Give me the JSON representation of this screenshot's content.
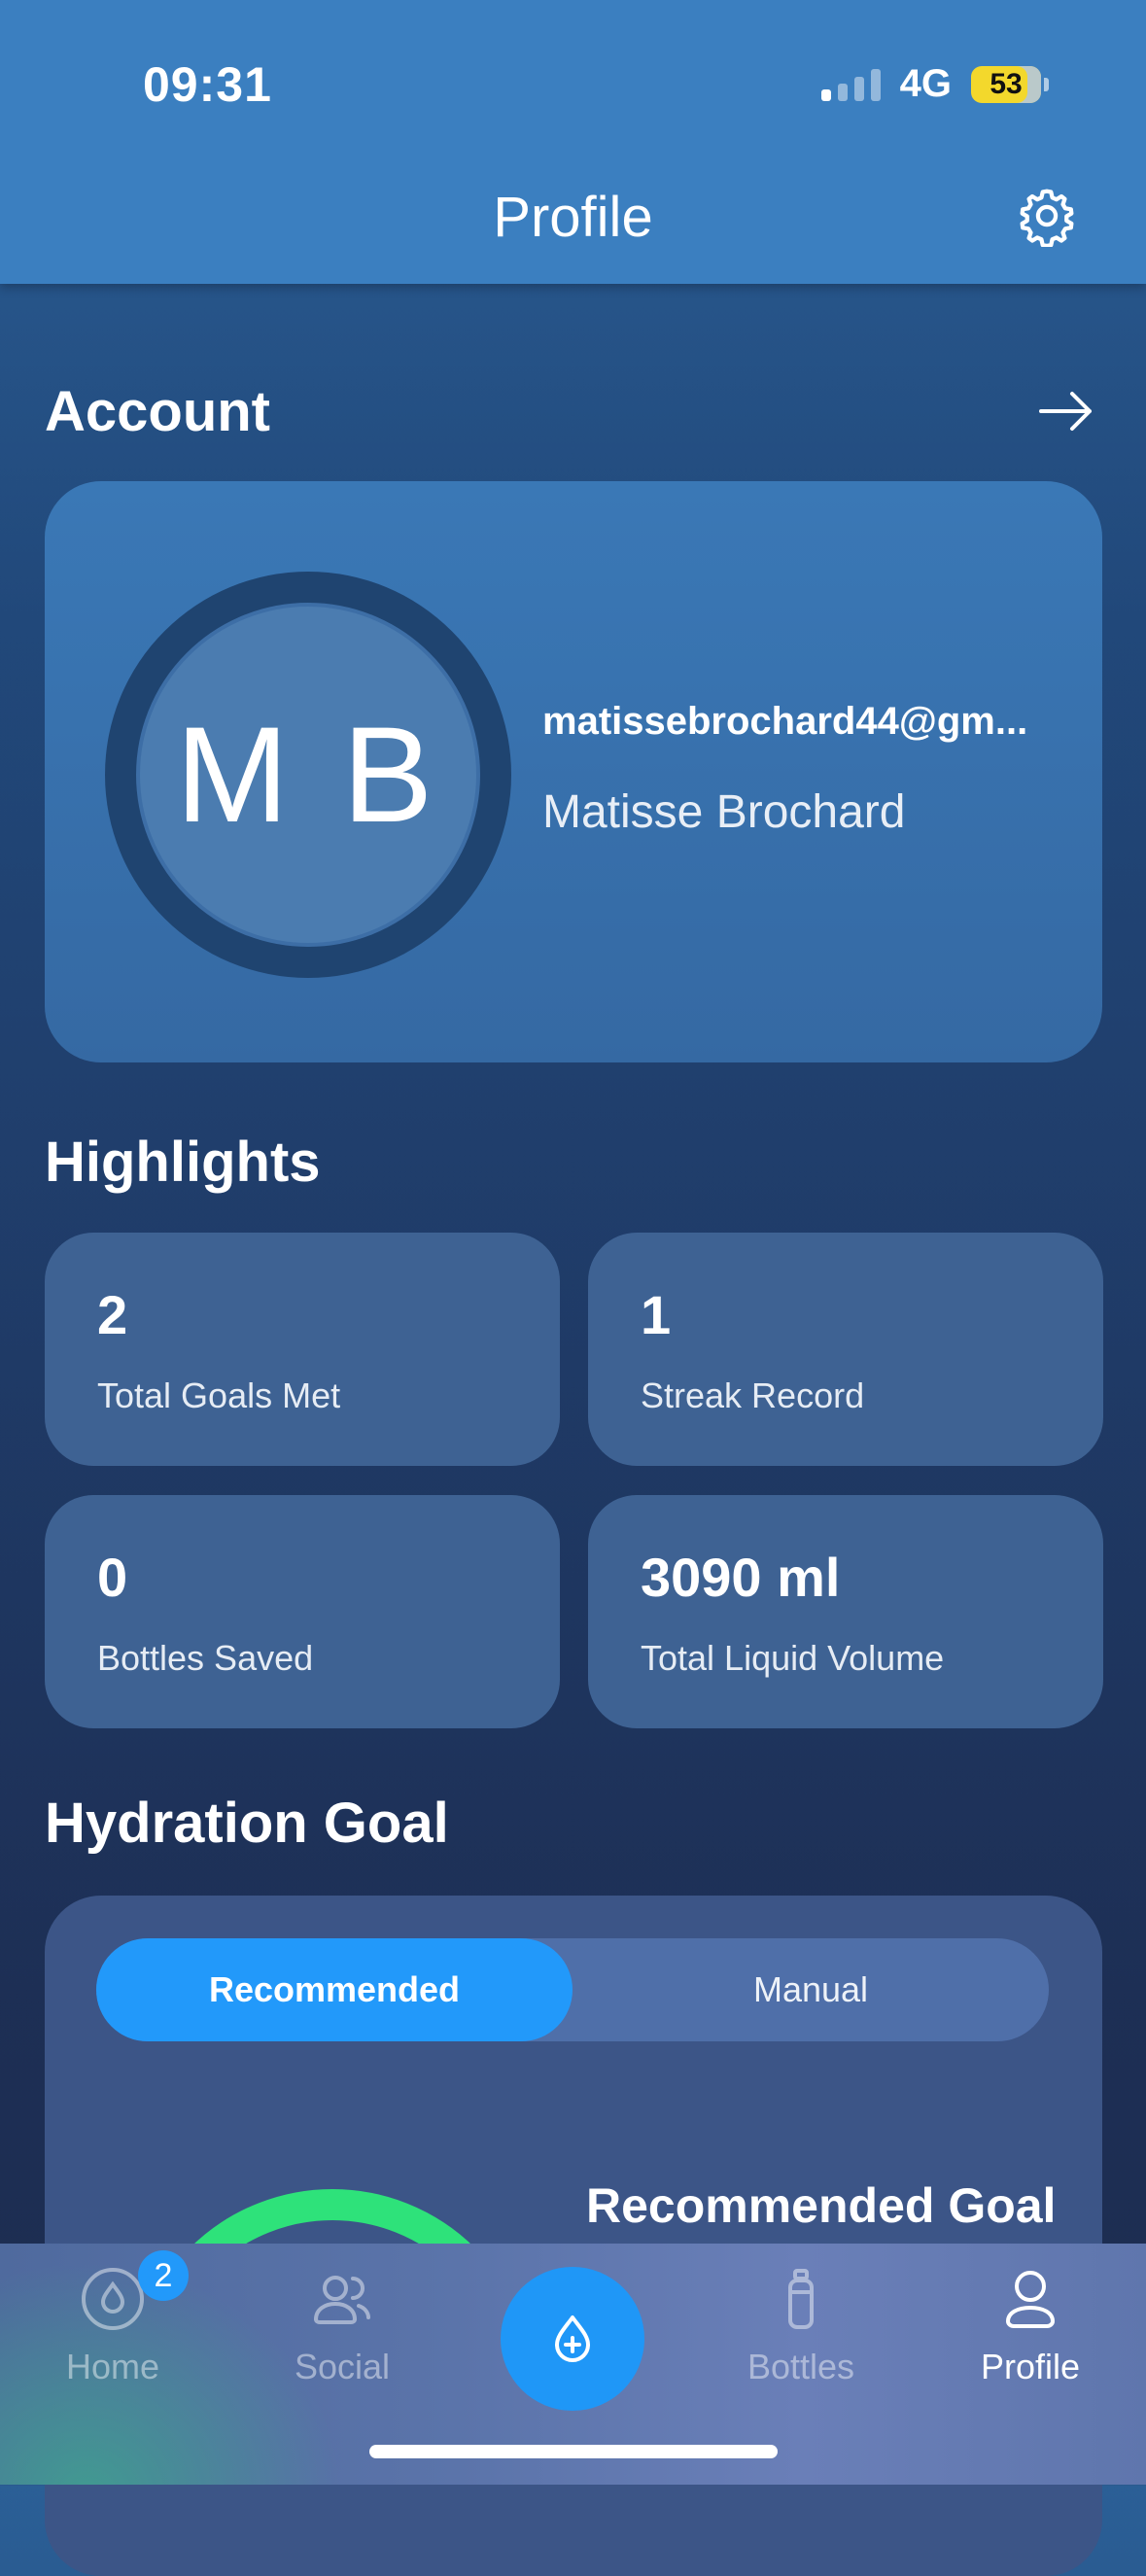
{
  "status_bar": {
    "time": "09:31",
    "network": "4G",
    "battery": "53"
  },
  "header": {
    "title": "Profile"
  },
  "account": {
    "title": "Account",
    "initials": "M B",
    "email": "matissebrochard44@gm...",
    "name": "Matisse Brochard"
  },
  "highlights": {
    "title": "Highlights",
    "items": [
      {
        "value": "2",
        "label": "Total Goals Met"
      },
      {
        "value": "1",
        "label": "Streak Record"
      },
      {
        "value": "0",
        "label": "Bottles Saved"
      },
      {
        "value": "3090 ml",
        "label": "Total Liquid Volume"
      }
    ]
  },
  "hydration_goal": {
    "title": "Hydration Goal",
    "options": [
      "Recommended",
      "Manual"
    ],
    "selected": "Recommended",
    "recommended_goal_title": "Recommended Goal",
    "gauge_color": "#2ee27a"
  },
  "tabbar": {
    "items": [
      {
        "label": "Home",
        "icon": "water-drop-icon",
        "badge": "2"
      },
      {
        "label": "Social",
        "icon": "people-icon"
      },
      {
        "label": "",
        "icon": "add-drink-icon"
      },
      {
        "label": "Bottles",
        "icon": "bottle-icon"
      },
      {
        "label": "Profile",
        "icon": "person-icon"
      }
    ],
    "active": "Profile"
  },
  "colors": {
    "accent": "#2299fa",
    "header": "#3b7fc0",
    "battery": "#f3d82c"
  }
}
